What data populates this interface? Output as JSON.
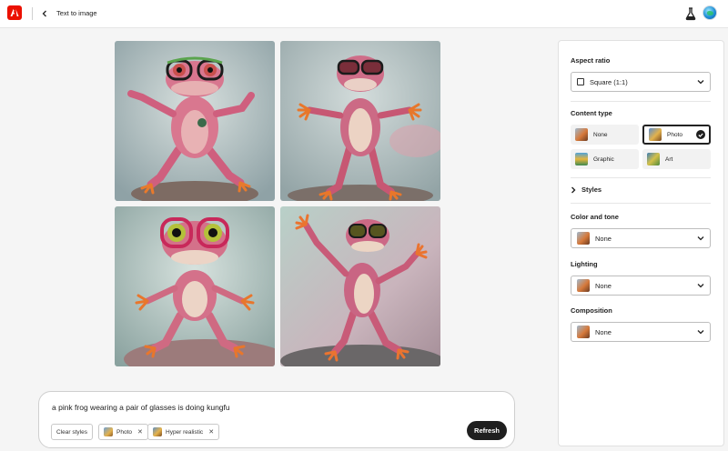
{
  "header": {
    "title": "Text to image",
    "logo_color": "#eb1000"
  },
  "icons": {
    "logo": "adobe-logo-icon",
    "back": "chevron-left-icon",
    "labs": "flask-icon",
    "avatar": "avatar"
  },
  "gallery": {
    "images": [
      {
        "subject": "pink frog with glasses in kung fu pose",
        "background": "#c2cfd0"
      },
      {
        "subject": "pink frog with glasses arms outstretched",
        "background": "#b9c6c8"
      },
      {
        "subject": "pink frog with glasses crouching",
        "background": "#b4c6c4"
      },
      {
        "subject": "pink frog with glasses dancing",
        "background": "#c6c0c2"
      }
    ]
  },
  "prompt": {
    "text": "a pink frog wearing a pair of glasses is doing kungfu",
    "chips": {
      "clear": "Clear styles",
      "photo": "Photo",
      "hyper": "Hyper realistic"
    },
    "refresh_label": "Refresh"
  },
  "panel": {
    "aspect_ratio": {
      "title": "Aspect ratio",
      "value": "Square (1:1)"
    },
    "content_type": {
      "title": "Content type",
      "options": [
        {
          "label": "None",
          "selected": false
        },
        {
          "label": "Photo",
          "selected": true
        },
        {
          "label": "Graphic",
          "selected": false
        },
        {
          "label": "Art",
          "selected": false
        }
      ]
    },
    "styles_label": "Styles",
    "color_and_tone": {
      "title": "Color and tone",
      "value": "None"
    },
    "lighting": {
      "title": "Lighting",
      "value": "None"
    },
    "composition": {
      "title": "Composition",
      "value": "None"
    }
  }
}
